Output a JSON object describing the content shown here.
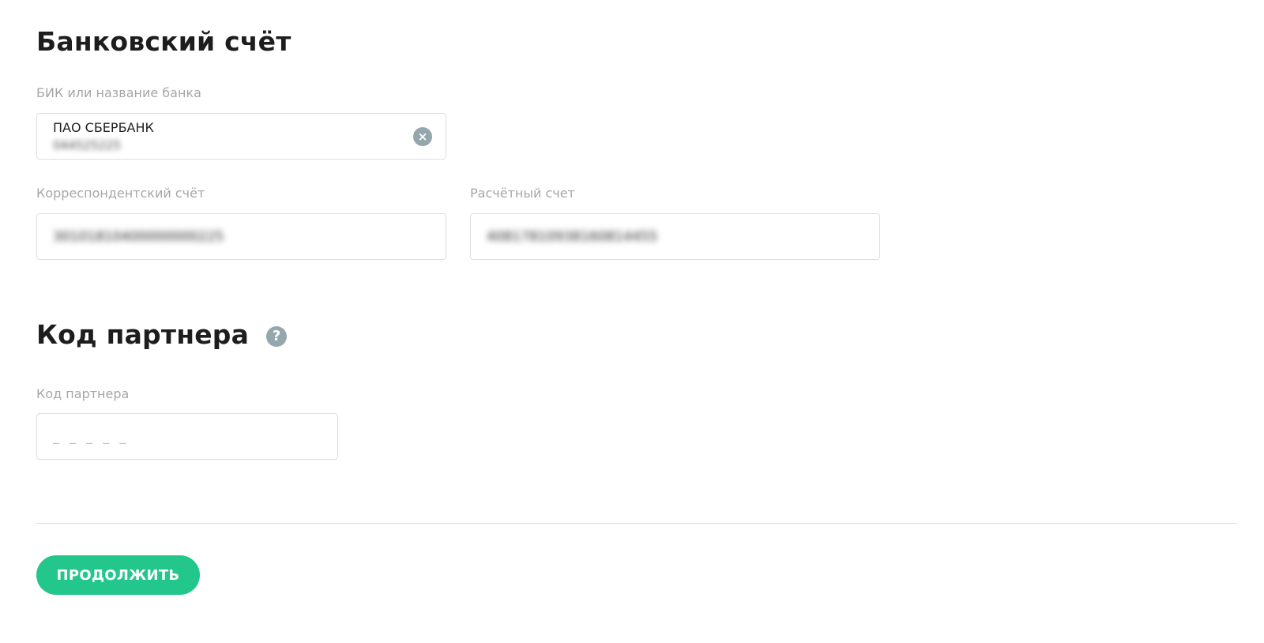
{
  "bank_section": {
    "title": "Банковский счёт",
    "bik_field": {
      "label": "БИК или название банка",
      "bank_name": "ПАО СБЕРБАНК",
      "bik_value": "044525225",
      "clear_icon": "close-circle-icon",
      "clear_glyph": "×"
    },
    "corr_account": {
      "label": "Корреспондентский счёт",
      "value": "30101810400000000225"
    },
    "settlement_account": {
      "label": "Расчётный счет",
      "value": "40817810938160814455"
    }
  },
  "partner_section": {
    "title": "Код партнера",
    "help_icon": "question-circle-icon",
    "help_glyph": "?",
    "code_field": {
      "label": "Код партнера",
      "placeholder": "_ _ _ _ _",
      "value": ""
    }
  },
  "actions": {
    "continue_label": "ПРОДОЛЖИТЬ"
  },
  "colors": {
    "accent": "#23c68b",
    "icon_gray": "#94a7ad",
    "label_gray": "#a6a6a6",
    "border": "#dcdfe1"
  }
}
